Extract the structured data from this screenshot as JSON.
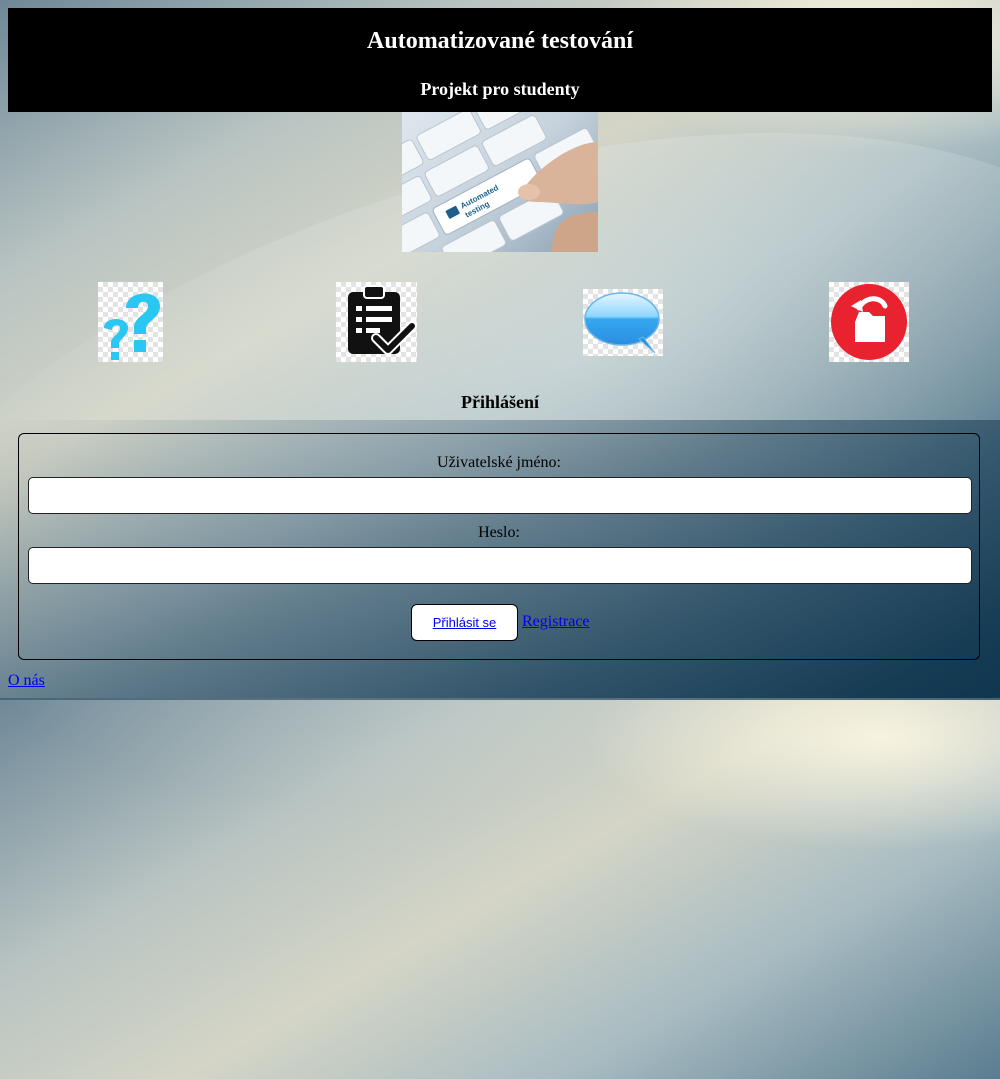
{
  "header": {
    "title": "Automatizované testování",
    "subtitle": "Projekt pro studenty"
  },
  "hero": {
    "key_label_line1": "Automated",
    "key_label_line2": "testing"
  },
  "nav_icons": [
    {
      "name": "help-icon"
    },
    {
      "name": "tasks-icon"
    },
    {
      "name": "chat-icon"
    },
    {
      "name": "logout-icon"
    }
  ],
  "login": {
    "title": "Přihlášení",
    "username_label": "Uživatelské jméno:",
    "username_value": "",
    "password_label": "Heslo:",
    "password_value": "",
    "submit_label": "Přihlásit se",
    "register_link": "Registrace"
  },
  "footer": {
    "about_link": "O nás"
  },
  "colors": {
    "header_bg": "#000000",
    "link": "#0000ee",
    "help_icon": "#29c7f2",
    "logout_icon": "#e8222f"
  }
}
